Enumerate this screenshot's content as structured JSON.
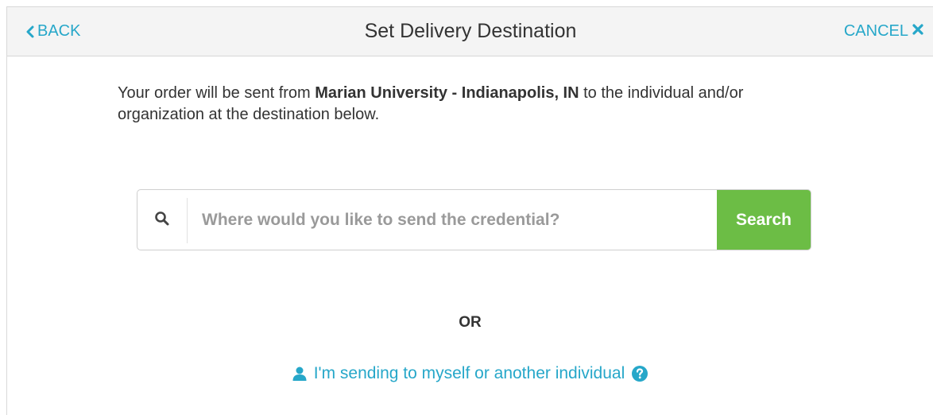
{
  "header": {
    "back_label": "BACK",
    "title": "Set Delivery Destination",
    "cancel_label": "CANCEL"
  },
  "intro": {
    "prefix": "Your order will be sent from ",
    "origin": "Marian University - Indianapolis, IN",
    "suffix": " to the individual and/or organization at the destination below."
  },
  "search": {
    "placeholder": "Where would you like to send the credential?",
    "value": "",
    "button_label": "Search"
  },
  "divider": {
    "label": "OR"
  },
  "self_option": {
    "label": "I'm sending to myself or another individual"
  },
  "icons": {
    "back": "chevron-left-icon",
    "cancel": "close-icon",
    "search": "search-icon",
    "user": "user-icon",
    "help": "question-circle-icon"
  },
  "colors": {
    "accent": "#26a7c9",
    "search_button": "#6cbd45",
    "header_bg": "#f4f4f4"
  }
}
